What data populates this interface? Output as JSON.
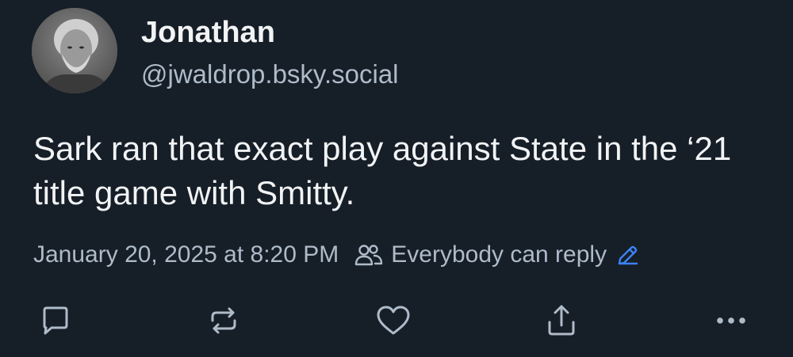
{
  "post": {
    "author": {
      "display_name": "Jonathan",
      "handle": "@jwaldrop.bsky.social",
      "avatar_icon": "avatar-photo"
    },
    "text": "Sark ran that exact play against State in the ‘21 title game with Smitty.",
    "timestamp": "January 20, 2025 at 8:20 PM",
    "reply_setting": {
      "label": "Everybody can reply",
      "icon": "people-icon",
      "edit_icon": "pencil-icon"
    }
  },
  "actions": [
    {
      "name": "reply",
      "icon": "comment-icon"
    },
    {
      "name": "repost",
      "icon": "repost-icon"
    },
    {
      "name": "like",
      "icon": "heart-icon"
    },
    {
      "name": "share",
      "icon": "share-icon"
    },
    {
      "name": "more",
      "icon": "ellipsis-icon"
    }
  ],
  "colors": {
    "background": "#161e27",
    "text_primary": "#f1f3f5",
    "text_secondary": "#aebbc9",
    "accent": "#3b82f6"
  }
}
